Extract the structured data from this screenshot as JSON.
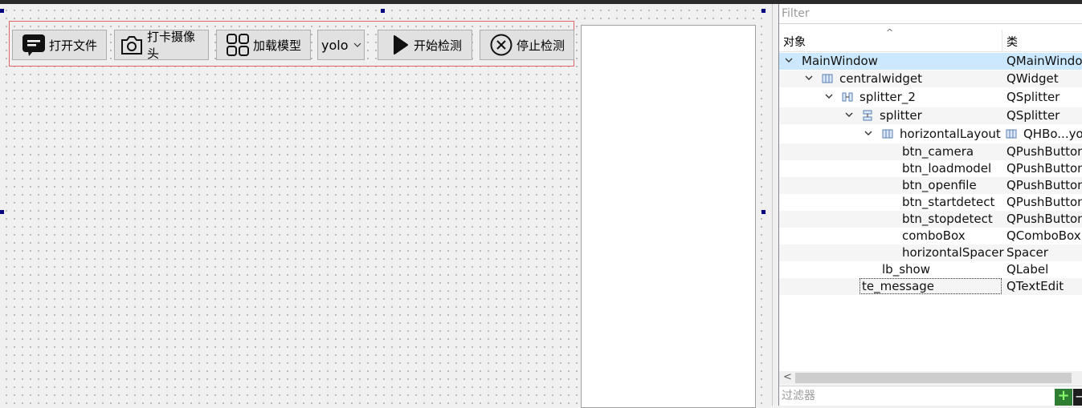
{
  "form": {
    "buttons": [
      {
        "id": "btn_openfile",
        "label": "打开文件",
        "icon": "message-icon"
      },
      {
        "id": "btn_camera",
        "label": "打卡摄像头",
        "icon": "camera-icon"
      },
      {
        "id": "btn_loadmodel",
        "label": "加载模型",
        "icon": "grid-icon"
      },
      {
        "id": "btn_startdetect",
        "label": "开始检测",
        "icon": "play-icon"
      },
      {
        "id": "btn_stopdetect",
        "label": "停止检测",
        "icon": "close-circle-icon"
      }
    ],
    "combo": {
      "value": "yolo",
      "icon": "chevron-down-icon"
    }
  },
  "inspector": {
    "filter_placeholder": "Filter",
    "header": {
      "col_object": "对象",
      "col_class": "类"
    },
    "rows": [
      {
        "name": "MainWindow",
        "class": "QMainWindo",
        "selected": true
      },
      {
        "name": "centralwidget",
        "class": "QWidget",
        "icon": "layout-icon"
      },
      {
        "name": "splitter_2",
        "class": "QSplitter",
        "icon": "splitter-horizontal-icon"
      },
      {
        "name": "splitter",
        "class": "QSplitter",
        "icon": "splitter-vertical-icon"
      },
      {
        "name": "horizontalLayout",
        "class": "QHBo...yo",
        "icon": "layout-icon",
        "class_icon": "layout-icon"
      },
      {
        "name": "btn_camera",
        "class": "QPushButton"
      },
      {
        "name": "btn_loadmodel",
        "class": "QPushButton"
      },
      {
        "name": "btn_openfile",
        "class": "QPushButton"
      },
      {
        "name": "btn_startdetect",
        "class": "QPushButton"
      },
      {
        "name": "btn_stopdetect",
        "class": "QPushButton"
      },
      {
        "name": "comboBox",
        "class": "QComboBox"
      },
      {
        "name": "horizontalSpacer",
        "class": "Spacer"
      },
      {
        "name": "lb_show",
        "class": "QLabel"
      },
      {
        "name": "te_message",
        "class": "QTextEdit",
        "focused": true
      }
    ],
    "bottom_filter_placeholder": "过滤器",
    "add_icon": "plus-icon",
    "remove_icon": "minus-icon"
  }
}
